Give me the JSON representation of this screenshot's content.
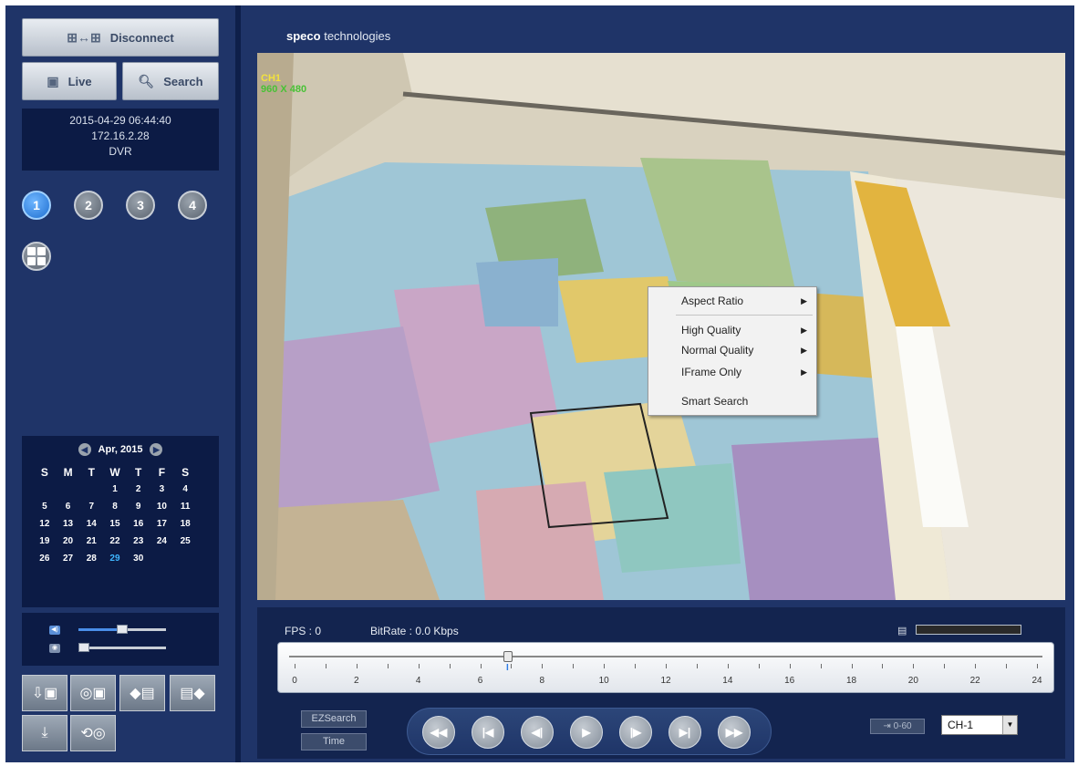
{
  "sidebar": {
    "disconnect_label": "Disconnect",
    "live_label": "Live",
    "search_label": "Search",
    "info": {
      "datetime": "2015-04-29 06:44:40",
      "ip": "172.16.2.28",
      "device": "DVR"
    },
    "channels": [
      "1",
      "2",
      "3",
      "4"
    ],
    "active_channel": "1",
    "calendar": {
      "month_label": "Apr, 2015",
      "weekdays": [
        "S",
        "M",
        "T",
        "W",
        "T",
        "F",
        "S"
      ],
      "weeks": [
        [
          "",
          "",
          "",
          "1",
          "2",
          "3",
          "4"
        ],
        [
          "5",
          "6",
          "7",
          "8",
          "9",
          "10",
          "11"
        ],
        [
          "12",
          "13",
          "14",
          "15",
          "16",
          "17",
          "18"
        ],
        [
          "19",
          "20",
          "21",
          "22",
          "23",
          "24",
          "25"
        ],
        [
          "26",
          "27",
          "28",
          "29",
          "30",
          "",
          ""
        ]
      ],
      "selected_day": "29"
    },
    "sliders": {
      "volume_level": 0.5,
      "other_level": 0.0
    }
  },
  "main": {
    "brand_bold": "speco",
    "brand_rest": "technologies",
    "overlay": {
      "channel": "CH1",
      "resolution": "960 X 480"
    },
    "context_menu": {
      "items": [
        "Aspect Ratio",
        "High Quality",
        "Normal Quality",
        "IFrame Only",
        "Smart Search"
      ]
    },
    "stats": {
      "fps": "FPS :  0",
      "bitrate": "BitRate : 0.0 Kbps"
    },
    "timeline": {
      "labels": [
        "0",
        "2",
        "4",
        "6",
        "8",
        "10",
        "12",
        "14",
        "16",
        "18",
        "20",
        "22",
        "24"
      ],
      "position_hour": 6.9
    },
    "ezsearch_label": "EZSearch",
    "time_label": "Time",
    "playback_buttons": [
      "◀◀",
      "|◀",
      "◀|",
      "▶",
      "|▶",
      "▶|",
      "▶▶"
    ],
    "interval_label": "⇥ 0-60",
    "channel_select_value": "CH-1"
  }
}
